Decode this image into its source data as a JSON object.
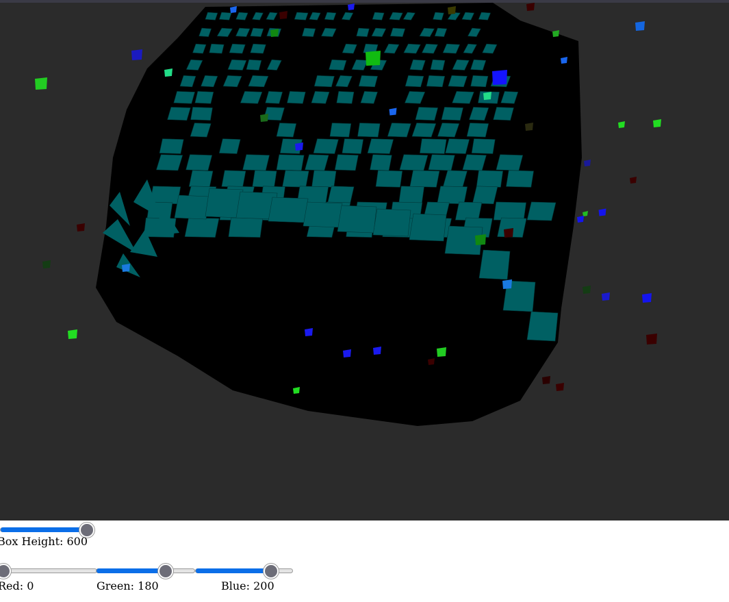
{
  "scene": {
    "background": "#2b2b2b",
    "box_color": "#006063",
    "box_shadow": "#000000"
  },
  "controls": {
    "box_height": {
      "label": "Box Height: 600",
      "value": 600,
      "fraction": 1.0
    },
    "red": {
      "label": "Red: 0",
      "value": 0,
      "fraction": 0.0
    },
    "green": {
      "label": "Green: 180",
      "value": 180,
      "fraction": 0.706
    },
    "blue": {
      "label": "Blue: 200",
      "value": 200,
      "fraction": 0.784
    },
    "accent": "#0b6ee8",
    "thumb": "#6d6d78"
  }
}
